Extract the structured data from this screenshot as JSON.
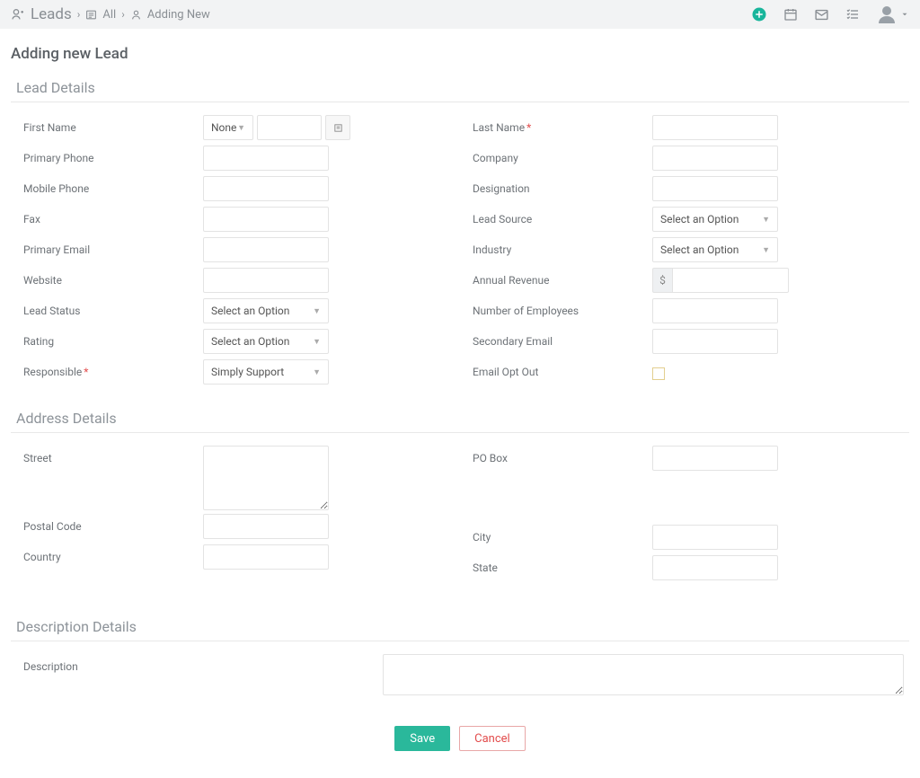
{
  "breadcrumb": {
    "module": "Leads",
    "mid": "All",
    "current": "Adding New"
  },
  "page_title": "Adding new Lead",
  "sections": {
    "lead_details": "Lead Details",
    "address_details": "Address Details",
    "description_details": "Description Details"
  },
  "labels": {
    "first_name": "First Name",
    "last_name": "Last Name",
    "primary_phone": "Primary Phone",
    "company": "Company",
    "mobile_phone": "Mobile Phone",
    "designation": "Designation",
    "fax": "Fax",
    "lead_source": "Lead Source",
    "primary_email": "Primary Email",
    "industry": "Industry",
    "website": "Website",
    "annual_revenue": "Annual Revenue",
    "lead_status": "Lead Status",
    "number_of_employees": "Number of Employees",
    "rating": "Rating",
    "secondary_email": "Secondary Email",
    "responsible": "Responsible",
    "email_opt_out": "Email Opt Out",
    "street": "Street",
    "po_box": "PO Box",
    "postal_code": "Postal Code",
    "city": "City",
    "country": "Country",
    "state": "State",
    "description": "Description"
  },
  "values": {
    "salutation": "None",
    "lead_source": "Select an Option",
    "industry": "Select an Option",
    "lead_status": "Select an Option",
    "rating": "Select an Option",
    "responsible": "Simply Support",
    "currency_symbol": "$"
  },
  "buttons": {
    "save": "Save",
    "cancel": "Cancel"
  }
}
